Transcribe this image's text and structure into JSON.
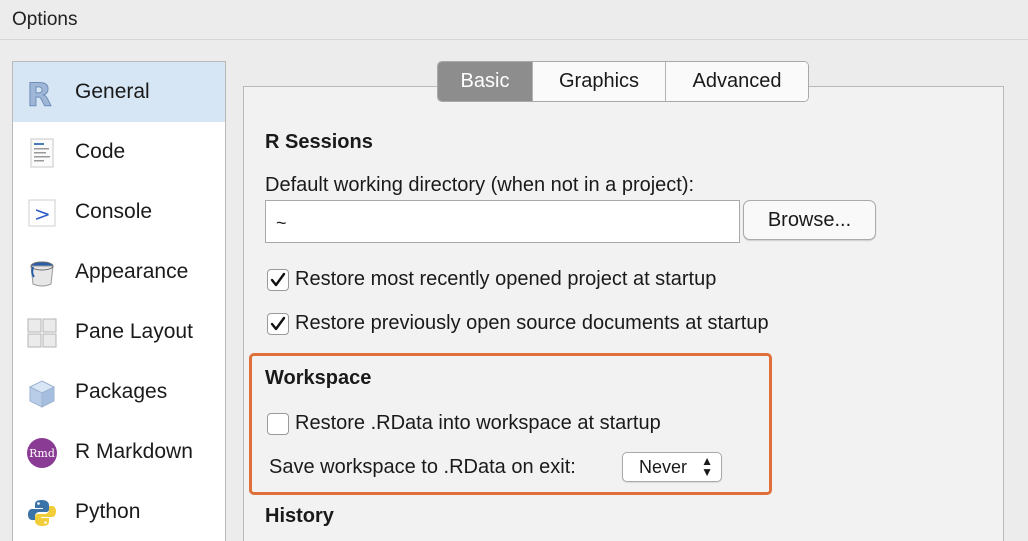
{
  "window": {
    "title": "Options"
  },
  "sidebar": {
    "items": [
      {
        "label": "General",
        "icon": "r-logo-icon"
      },
      {
        "label": "Code",
        "icon": "code-doc-icon"
      },
      {
        "label": "Console",
        "icon": "console-prompt-icon"
      },
      {
        "label": "Appearance",
        "icon": "paint-bucket-icon"
      },
      {
        "label": "Pane Layout",
        "icon": "pane-grid-icon"
      },
      {
        "label": "Packages",
        "icon": "package-box-icon"
      },
      {
        "label": "R Markdown",
        "icon": "rmd-icon"
      },
      {
        "label": "Python",
        "icon": "python-icon"
      }
    ],
    "selected": "General"
  },
  "tabs": [
    {
      "label": "Basic",
      "active": true
    },
    {
      "label": "Graphics",
      "active": false
    },
    {
      "label": "Advanced",
      "active": false
    }
  ],
  "r_sessions": {
    "heading": "R Sessions",
    "working_dir_label": "Default working directory (when not in a project):",
    "working_dir_value": "~",
    "browse_label": "Browse...",
    "restore_project_label": "Restore most recently opened project at startup",
    "restore_project_checked": true,
    "restore_docs_label": "Restore previously open source documents at startup",
    "restore_docs_checked": true
  },
  "workspace": {
    "heading": "Workspace",
    "restore_rdata_label": "Restore .RData into workspace at startup",
    "restore_rdata_checked": false,
    "save_label": "Save workspace to .RData on exit:",
    "save_value": "Never"
  },
  "history": {
    "heading": "History"
  },
  "colors": {
    "highlight": "#e0703a",
    "selected_item": "#d6e6f5",
    "active_tab": "#8d8d8d"
  }
}
